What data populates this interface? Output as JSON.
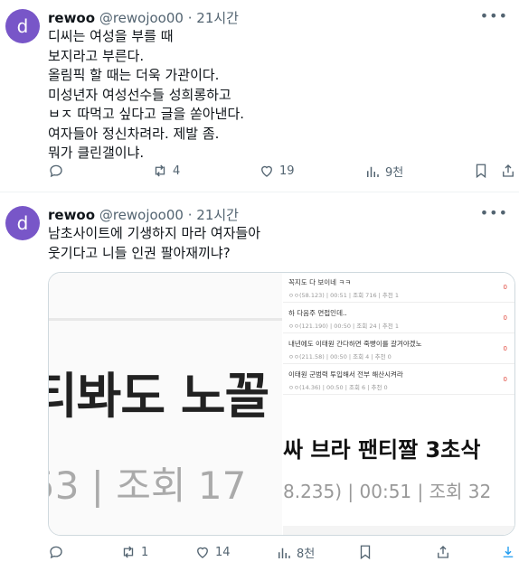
{
  "tweets": [
    {
      "avatar_letter": "d",
      "name": "rewoo",
      "handle": "@rewojoo00",
      "dot": "·",
      "time": "21시간",
      "lines": [
        "디씨는 여성을 부를 때",
        "보지라고 부른다.",
        "올림픽 할 때는 더욱 가관이다.",
        "미성년자 여성선수들 성희롱하고",
        "ㅂㅈ 따먹고 싶다고 글을 쏟아낸다.",
        "여자들아 정신차려라. 제발 좀.",
        "뭐가 클린갤이냐."
      ],
      "actions": {
        "reply": "",
        "retweet": "4",
        "like": "19",
        "views": "9천"
      }
    },
    {
      "avatar_letter": "d",
      "name": "rewoo",
      "handle": "@rewojoo00",
      "dot": "·",
      "time": "21시간",
      "lines": [
        "남초사이트에 기생하지 마라 여자들아",
        "웃기다고 니들 인권 팔아재끼냐?"
      ],
      "actions": {
        "reply": "",
        "retweet": "1",
        "like": "14",
        "views": "8천"
      },
      "media": {
        "left": {
          "big_text": "티봐도 노꼴",
          "meta_text": "53 | 조회 17"
        },
        "right": {
          "rows": [
            {
              "title": "꼭지도 다 보이네 ㅋㅋ",
              "sub": "ㅇㅇ(58.123)  |  00:51  |  조회 716  |  추천 1",
              "count": "0"
            },
            {
              "title": "하 다음주 면접인데..",
              "sub": "ㅇㅇ(121.190)  |  00:50  |  조회 24  |  추천 1",
              "count": "0"
            },
            {
              "title": "내년에도 이태원 간다하면 죽빵이를 갈겨야겠노",
              "sub": "ㅇㅇ(211.58)  |  00:50  |  조회 4  |  추천 0",
              "count": "0"
            },
            {
              "title": "이태원 군범력 투입해서 전부 해산시켜라",
              "sub": "ㅇㅇ(14.36)  |  00:50  |  조회 6  |  추천 0",
              "count": "0"
            }
          ],
          "big_title": "싸 브라 팬티짤 3초삭",
          "big_sub": "8.235)  |  00:51  |  조회 32"
        }
      }
    }
  ]
}
